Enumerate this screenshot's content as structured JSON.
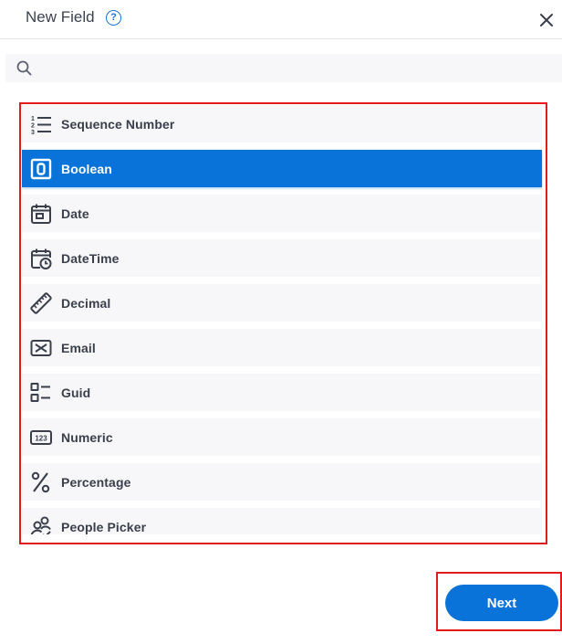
{
  "dialog": {
    "title": "New Field",
    "help_glyph": "?"
  },
  "search": {
    "value": "",
    "placeholder": ""
  },
  "field_types": [
    {
      "label": "Sequence Number",
      "icon": "sequence-number-icon",
      "selected": false
    },
    {
      "label": "Boolean",
      "icon": "boolean-icon",
      "selected": true
    },
    {
      "label": "Date",
      "icon": "calendar-icon",
      "selected": false
    },
    {
      "label": "DateTime",
      "icon": "calendar-clock-icon",
      "selected": false
    },
    {
      "label": "Decimal",
      "icon": "ruler-icon",
      "selected": false
    },
    {
      "label": "Email",
      "icon": "envelope-icon",
      "selected": false
    },
    {
      "label": "Guid",
      "icon": "guid-list-icon",
      "selected": false
    },
    {
      "label": "Numeric",
      "icon": "numeric-123-icon",
      "selected": false
    },
    {
      "label": "Percentage",
      "icon": "percent-icon",
      "selected": false
    },
    {
      "label": "People Picker",
      "icon": "people-picker-icon",
      "selected": false
    }
  ],
  "footer": {
    "next_label": "Next"
  },
  "colors": {
    "accent": "#0a73d9",
    "highlight_border": "#e31b1b",
    "item_background": "#f7f7f9"
  }
}
